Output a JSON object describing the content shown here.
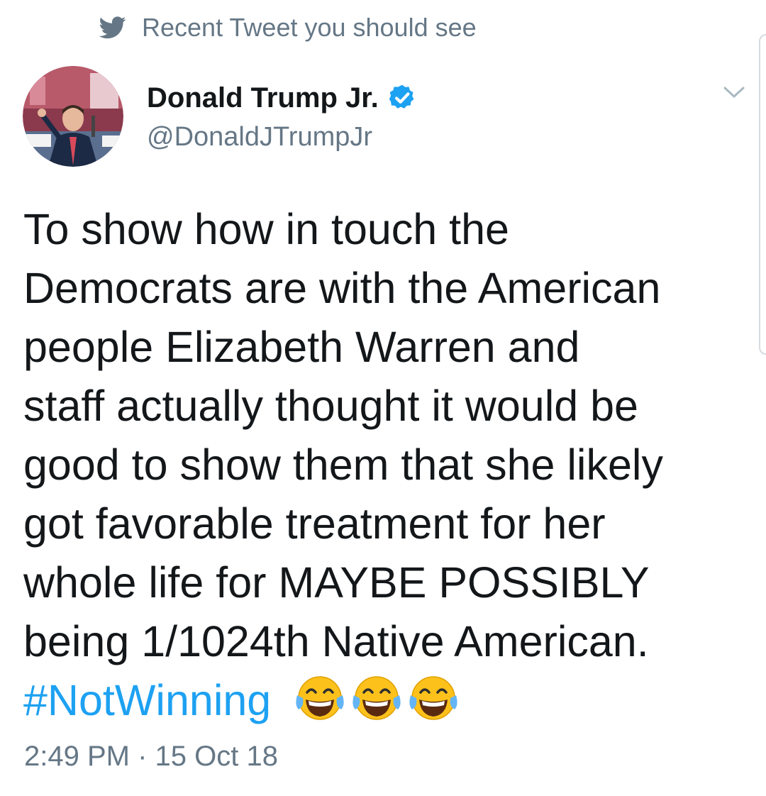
{
  "context": {
    "icon": "twitter-bird-icon",
    "text": "Recent Tweet you should see"
  },
  "author": {
    "name": "Donald Trump Jr.",
    "handle": "@DonaldJTrumpJr",
    "verified": true
  },
  "tweet": {
    "lines": [
      "To show how in touch the",
      "Democrats are with the American",
      "people Elizabeth Warren and",
      "staff actually thought it would be",
      "good to show them that she likely",
      "got favorable treatment for her",
      "whole life for MAYBE POSSIBLY",
      "being 1/1024th Native American."
    ],
    "hashtag": "#NotWinning",
    "emojis": [
      "face-with-tears-of-joy-icon",
      "face-with-tears-of-joy-icon",
      "face-with-tears-of-joy-icon"
    ]
  },
  "timestamp": "2:49 PM · 15 Oct 18",
  "colors": {
    "link": "#1da1f2",
    "secondary_text": "#657786",
    "primary_text": "#14171a"
  }
}
